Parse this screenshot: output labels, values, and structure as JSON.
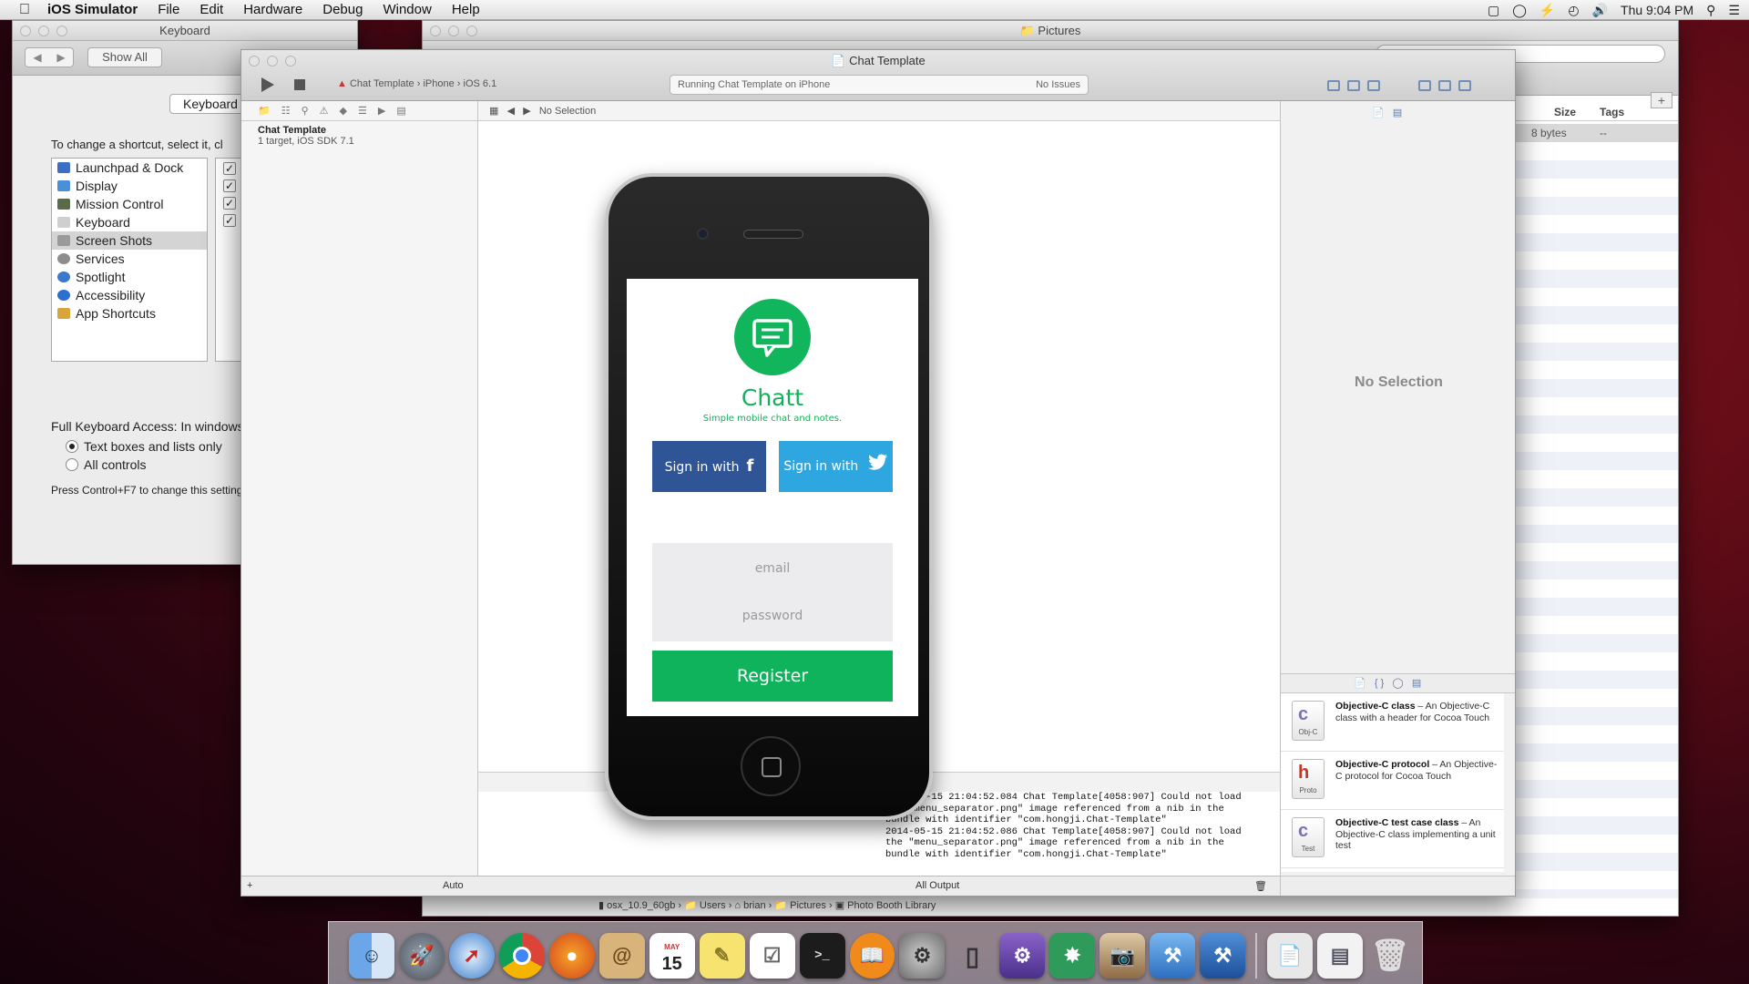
{
  "menubar": {
    "app_name": "iOS Simulator",
    "items": [
      "File",
      "Edit",
      "Hardware",
      "Debug",
      "Window",
      "Help"
    ],
    "clock": "Thu 9:04 PM"
  },
  "keyboard_prefs": {
    "title": "Keyboard",
    "show_all": "Show All",
    "tab": "Keyboard",
    "prompt": "To change a shortcut, select it, cl",
    "categories": [
      "Launchpad & Dock",
      "Display",
      "Mission Control",
      "Keyboard",
      "Screen Shots",
      "Services",
      "Spotlight",
      "Accessibility",
      "App Shortcuts"
    ],
    "selected_category": "Screen Shots",
    "full_access_label": "Full Keyboard Access: In windows",
    "radio_1": "Text boxes and lists only",
    "radio_2": "All controls",
    "hint": "Press Control+F7 to change this setting"
  },
  "pictures_window": {
    "title": "Pictures",
    "col_size": "Size",
    "col_tags": "Tags",
    "row_size": "8 bytes",
    "row_tags": "--"
  },
  "xcode": {
    "title": "Chat Template",
    "scheme": "Chat Template",
    "device": "iPhone",
    "sdk": "iOS 6.1",
    "status": "Running Chat Template on iPhone",
    "issues": "No Issues",
    "project_name": "Chat Template",
    "project_detail": "1 target, iOS SDK 7.1",
    "jump_bar": "No Selection",
    "inspector_empty": "No Selection",
    "console_filter_left": "Auto",
    "console_filter_right": "All Output",
    "console_lines": [
      "2014-05-15 21:04:52.084 Chat Template[4058:907] Could not load",
      "the \"menu_separator.png\" image referenced from a nib in the",
      "bundle with identifier \"com.hongji.Chat-Template\"",
      "2014-05-15 21:04:52.086 Chat Template[4058:907] Could not load",
      "the \"menu_separator.png\" image referenced from a nib in the",
      "bundle with identifier \"com.hongji.Chat-Template\""
    ],
    "library": [
      {
        "name": "Objective-C class",
        "desc": " – An Objective-C class with a header for Cocoa Touch",
        "glyph": "c",
        "tag": "Obj-C",
        "color": "#7d6fb3"
      },
      {
        "name": "Objective-C protocol",
        "desc": " – An Objective-C protocol for Cocoa Touch",
        "glyph": "h",
        "tag": "Proto",
        "color": "#c0392b"
      },
      {
        "name": "Objective-C test case class",
        "desc": " – An Objective-C class implementing a unit test",
        "glyph": "c",
        "tag": "Test",
        "color": "#7d6fb3"
      }
    ]
  },
  "status_path": [
    "osx_10.9_60gb",
    "Users",
    "brian",
    "Pictures",
    "Photo Booth Library"
  ],
  "app_screen": {
    "title": "Chatt",
    "tagline": "Simple mobile chat and notes.",
    "sign_in_label": "Sign in with",
    "facebook_glyph": "f",
    "email_placeholder": "email",
    "password_placeholder": "password",
    "register": "Register",
    "colors": {
      "brand_green": "#10b55c",
      "facebook": "#2f5596",
      "twitter": "#2ea7e0"
    }
  },
  "dock": {
    "icons": [
      "finder-icon",
      "launchpad-icon",
      "safari-icon",
      "chrome-icon",
      "firefox-icon",
      "contacts-icon",
      "calendar-icon",
      "notes-icon",
      "reminders-icon",
      "terminal-icon",
      "ibooks-icon",
      "system-preferences-icon",
      "ios-simulator-icon",
      "instruments-icon",
      "sourcetree-icon",
      "preview-icon",
      "xcode-icon",
      "xcode-tools-icon",
      "documents-icon",
      "downloads-icon",
      "trash-icon"
    ],
    "calendar_day": "15",
    "calendar_month": "MAY",
    "terminal_prompt": ">_"
  }
}
